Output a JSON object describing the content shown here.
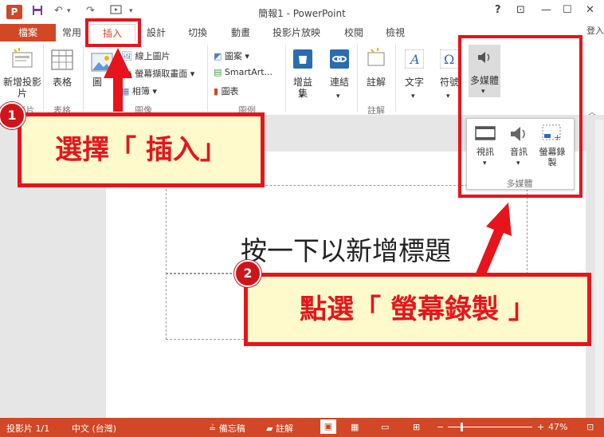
{
  "window": {
    "title": "簡報1 - PowerPoint",
    "app_logo": "P",
    "controls": {
      "help": "?",
      "ribbon_display": "⊡",
      "minimize": "—",
      "maximize": "☐",
      "close": "✕"
    }
  },
  "quick_access": {
    "save_icon": "save-icon",
    "undo_icon": "undo-icon",
    "redo_icon": "redo-icon",
    "present_icon": "present-icon"
  },
  "tabs": {
    "file": "檔案",
    "items": [
      "常用",
      "插入",
      "設計",
      "切換",
      "動畫",
      "投影片放映",
      "校閱",
      "檢視"
    ],
    "active": "插入",
    "signin": "登入"
  },
  "ribbon": {
    "slides": {
      "new_slide": "新增投影片",
      "group": "投影片"
    },
    "tables": {
      "table": "表格",
      "group": "表格"
    },
    "images": {
      "pictures": "圖",
      "online_pictures": "線上圖片",
      "screenshot": "螢幕擷取畫面",
      "album": "相簿",
      "group": "圖像"
    },
    "illustrations": {
      "shapes": "圖案",
      "smartart": "SmartArt...",
      "chart": "圖表",
      "group": "圖例"
    },
    "apps": {
      "store": "增益集"
    },
    "links": {
      "link": "連結"
    },
    "comments": {
      "comment": "註解",
      "group": "註解"
    },
    "text": {
      "text": "文字"
    },
    "symbols": {
      "symbol": "符號"
    },
    "media": {
      "multimedia": "多媒體"
    }
  },
  "media_dropdown": {
    "video": "視訊",
    "audio": "音訊",
    "screen_recording": "螢幕錄製",
    "group": "多媒體"
  },
  "slide": {
    "title_placeholder": "按一下以新增標題"
  },
  "statusbar": {
    "slide": "投影片 1/1",
    "language": "中文 (台灣)",
    "notes": "備忘稿",
    "comments": "註解",
    "zoom": "47%"
  },
  "annotations": {
    "badge1": "1",
    "callout1": "選擇「 插入」",
    "badge2": "2",
    "callout2": "點選「 螢幕錄製 」"
  },
  "colors": {
    "accent": "#d24726",
    "annotation_red": "#e8141b",
    "callout_bg": "#fffacc"
  }
}
